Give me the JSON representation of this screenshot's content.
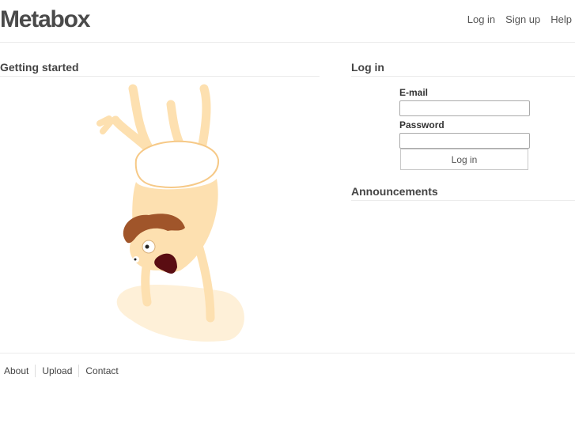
{
  "header": {
    "logo": "Metabox",
    "nav": {
      "login": "Log in",
      "signup": "Sign up",
      "help": "Help"
    }
  },
  "main": {
    "getting_started_title": "Getting started",
    "illustration_icon": "handstand-character-illustration"
  },
  "login": {
    "title": "Log in",
    "email_label": "E-mail",
    "email_value": "",
    "password_label": "Password",
    "password_value": "",
    "button_label": "Log in"
  },
  "announcements": {
    "title": "Announcements"
  },
  "footer": {
    "about": "About",
    "upload": "Upload",
    "contact": "Contact"
  },
  "colors": {
    "skin": "#fde0b0",
    "skin_outline": "#f6c987",
    "hair": "#a0552a",
    "mouth": "#5a0d12"
  }
}
